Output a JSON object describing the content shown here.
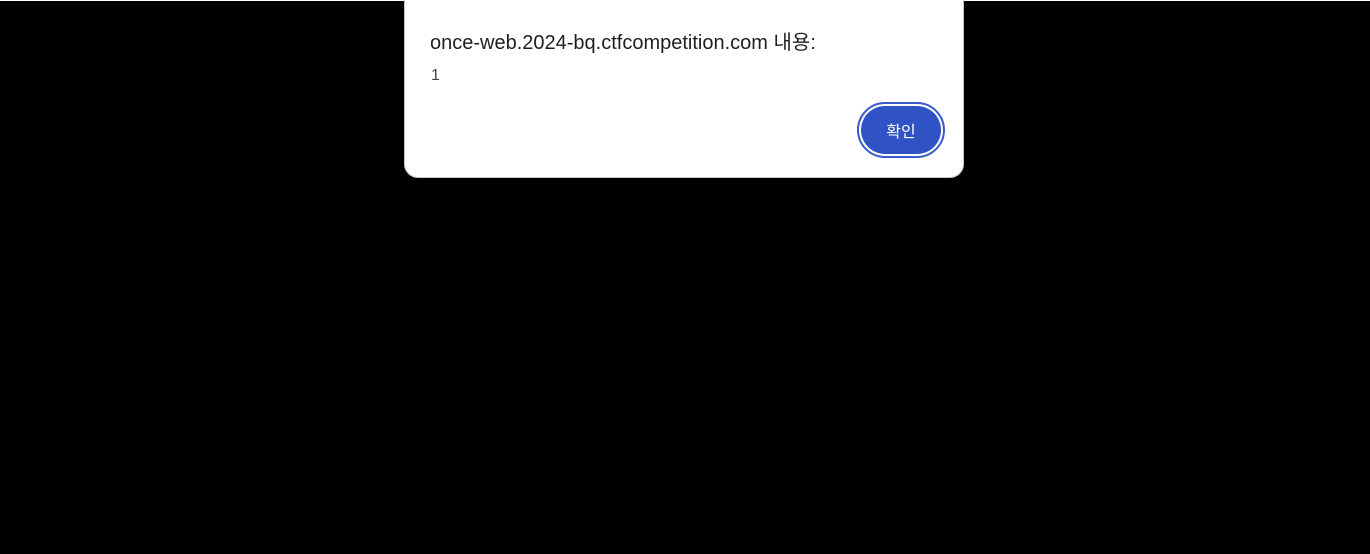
{
  "dialog": {
    "title": "once-web.2024-bq.ctfcompetition.com 내용:",
    "message": "1",
    "ok_label": "확인"
  },
  "colors": {
    "background": "#000000",
    "dialog_bg": "#ffffff",
    "accent": "#2f52c4"
  }
}
